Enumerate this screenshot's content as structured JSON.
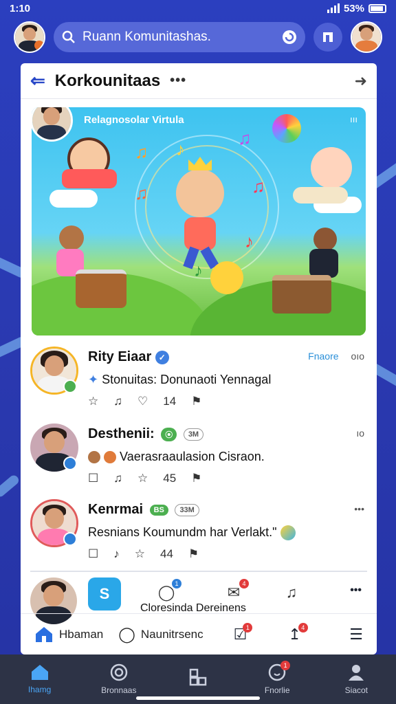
{
  "status_bar": {
    "time": "1:10",
    "battery": "53%"
  },
  "top_bar": {
    "search_placeholder": "Ruann Komunitashas.",
    "search_icon": "search-icon",
    "refresh_icon": "refresh-icon",
    "app_icon": "page-icon"
  },
  "panel": {
    "title": "Korkounitaas",
    "more_label": "•••",
    "back_icon": "back-arrow-icon",
    "share_icon": "share-icon"
  },
  "banner": {
    "caption": "Relagnosolar Virtula",
    "corner_text": "ııı"
  },
  "posts": [
    {
      "name": "Rity Eiaar",
      "verified_icon": "verified-icon",
      "text": "Stonuitas: Donunaoti Yennagal",
      "follow_label": "Fnaore",
      "right_label": "oıo",
      "like_count": "",
      "comment_count": "14",
      "badge_color": "#4caf50"
    },
    {
      "name": "Desthenii:",
      "pill_1": "⦿",
      "pill_2": "3M",
      "text": "Vaerasraaulasion Cisraon.",
      "right_label": "ıo",
      "comment_count": "45",
      "badge_color": "#2e7fd8"
    },
    {
      "name": "Kenrmai",
      "pill_1": "BS",
      "pill_2": "33M",
      "text": "Resnians Koumundm har Verlakt.\"",
      "right_label": "•••",
      "comment_count": "44",
      "badge_color": "#2e7fd8"
    }
  ],
  "shortcut_row": {
    "label": "Cloresinda Dereinens",
    "badge_1": "1",
    "badge_2": "4",
    "more_label": "•••"
  },
  "sub_nav": {
    "item_1": "Hbaman",
    "item_2": "Naunitrsenc",
    "badge_1": "1",
    "badge_2": "4"
  },
  "bottom_nav": {
    "items": [
      {
        "label": "Ihamg",
        "icon": "home-icon"
      },
      {
        "label": "Bronnaas",
        "icon": "circle-icon"
      },
      {
        "label": "",
        "icon": "groups-icon"
      },
      {
        "label": "Fnorlie",
        "icon": "bell-icon",
        "badge": "1"
      },
      {
        "label": "Siacot",
        "icon": "profile-icon"
      }
    ]
  },
  "colors": {
    "background": "#2a39b0",
    "accent": "#2a49c8",
    "panel": "#ffffff",
    "bottom_nav": "#2d3346"
  }
}
